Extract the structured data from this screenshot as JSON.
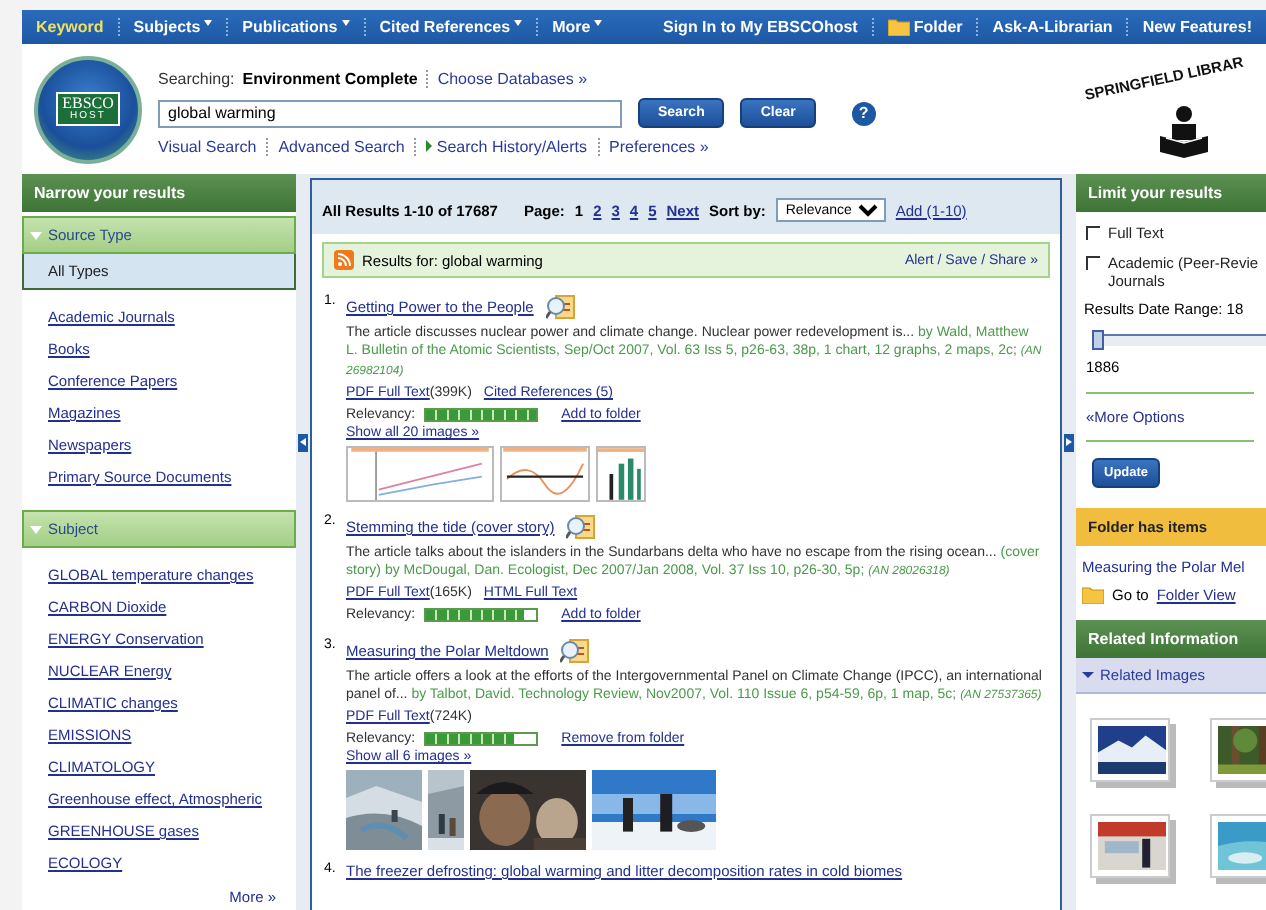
{
  "topnav": {
    "left": [
      {
        "label": "Keyword",
        "selected": true,
        "dropdown": false
      },
      {
        "label": "Subjects",
        "selected": false,
        "dropdown": true
      },
      {
        "label": "Publications",
        "selected": false,
        "dropdown": true
      },
      {
        "label": "Cited References",
        "selected": false,
        "dropdown": true
      },
      {
        "label": "More",
        "selected": false,
        "dropdown": true
      }
    ],
    "right": [
      {
        "label": "Sign In to My EBSCOhost",
        "kind": "link"
      },
      {
        "label": "Folder",
        "kind": "folder"
      },
      {
        "label": "Ask-A-Librarian",
        "kind": "link"
      },
      {
        "label": "New Features!",
        "kind": "link"
      }
    ]
  },
  "header": {
    "logo": "EBSCO",
    "logo_sub": "HOST",
    "searching_label": "Searching:",
    "database": "Environment Complete",
    "choose": "Choose Databases »",
    "query": "global warming",
    "buttons": [
      "Search",
      "Clear"
    ],
    "help": "?",
    "links": [
      {
        "label": "Visual Search",
        "arrow": false
      },
      {
        "label": "Advanced Search",
        "arrow": false
      },
      {
        "label": "Search History/Alerts",
        "arrow": true
      },
      {
        "label": "Preferences »",
        "arrow": false
      }
    ],
    "library": "SPRINGFIELD LIBRAR"
  },
  "left": {
    "title": "Narrow your results",
    "sections": [
      {
        "title": "Source Type",
        "expanded": true,
        "all_label": "All Types",
        "items": [
          "Academic Journals",
          "Books",
          "Conference Papers",
          "Magazines",
          "Newspapers",
          "Primary Source Documents"
        ]
      },
      {
        "title": "Subject",
        "expanded": true,
        "items": [
          "GLOBAL temperature changes",
          "CARBON Dioxide",
          "ENERGY Conservation",
          "NUCLEAR Energy",
          "CLIMATIC changes",
          "EMISSIONS",
          "CLIMATOLOGY",
          "Greenhouse effect, Atmospheric",
          "GREENHOUSE gases",
          "ECOLOGY"
        ],
        "more": "More »"
      }
    ]
  },
  "results": {
    "summary": "All Results 1-10 of 17687",
    "page_label": "Page:",
    "pages": [
      {
        "label": "1",
        "selected": true
      },
      {
        "label": "2",
        "selected": false
      },
      {
        "label": "3",
        "selected": false
      },
      {
        "label": "4",
        "selected": false
      },
      {
        "label": "5",
        "selected": false
      }
    ],
    "next": "Next",
    "sort_label": "Sort by:",
    "sort": "Relevance",
    "add": "Add (1-10)",
    "rss_label": "Results for: global warming",
    "alert": "Alert / Save / Share »",
    "items": [
      {
        "number": "1.",
        "title": "Getting Power to the People",
        "abstract": "The article discusses nuclear power and climate change. Nuclear power redevelopment is...",
        "citation": "by Wald, Matthew L. Bulletin of the Atomic Scientists, Sep/Oct 2007, Vol. 63 Iss 5, p26-63, 38p, 1 chart, 12 graphs, 2 maps, 2c;",
        "an": "(AN 26982104)",
        "links": [
          {
            "label": "PDF Full Text",
            "size": "(399K)"
          },
          {
            "label": "Cited References (5)"
          }
        ],
        "relevancy_label": "Relevancy:",
        "level": 1,
        "folder_action": "Add to folder",
        "images_link": "Show all 20 images »",
        "images": [
          {
            "kind": "chart"
          },
          {
            "kind": "chart"
          },
          {
            "kind": "chart"
          }
        ]
      },
      {
        "number": "2.",
        "title": "Stemming the tide (cover story)",
        "abstract": "The article talks about the islanders in the Sundarbans delta who have no escape from the rising ocean...",
        "citation": "(cover story) by McDougal, Dan. Ecologist, Dec 2007/Jan 2008, Vol. 37 Iss 10, p26-30, 5p;",
        "an": "(AN 28026318)",
        "links": [
          {
            "label": "PDF Full Text",
            "size": "(165K)"
          },
          {
            "label": "HTML Full Text"
          }
        ],
        "relevancy_label": "Relevancy:",
        "level": 0.9,
        "folder_action": "Add to folder"
      },
      {
        "number": "3.",
        "title": "Measuring the Polar Meltdown",
        "abstract": "The article offers a look at the efforts of the Intergovernmental Panel on Climate Change (IPCC), an international panel of...",
        "citation": "by Talbot, David. Technology Review, Nov2007, Vol. 110 Issue 6, p54-59, 6p, 1 map, 5c;",
        "an": "(AN 27537365)",
        "links": [
          {
            "label": "PDF Full Text",
            "size": "(724K)"
          }
        ],
        "relevancy_label": "Relevancy:",
        "level": 0.8,
        "folder_action": "Remove from folder",
        "images_link": "Show all 6 images »",
        "images": [
          {
            "kind": "picture"
          },
          {
            "kind": "picture"
          },
          {
            "kind": "picture"
          },
          {
            "kind": "picture"
          }
        ]
      },
      {
        "number": "4.",
        "title": "The freezer defrosting: global warming and litter decomposition rates in cold biomes"
      }
    ]
  },
  "right": {
    "title": "Limit your results",
    "checkboxes": [
      {
        "lines": [
          "Full Text"
        ],
        "checked": false
      },
      {
        "lines": [
          "Academic (Peer-Revie",
          "Journals"
        ],
        "checked": false
      }
    ],
    "date_label": "Results Date Range: 18",
    "slider": {
      "level": 0,
      "value": "1886"
    },
    "more_options": "«More Options",
    "update": "Update",
    "folder": {
      "title": "Folder has items",
      "items": [
        "Measuring the Polar Mel"
      ],
      "goto": "Go to",
      "view": "Folder View"
    },
    "related": {
      "title": "Related Information",
      "section": "Related Images",
      "expanded": true,
      "images": [
        {
          "kind": "picture"
        },
        {
          "kind": "picture"
        },
        {
          "kind": "picture"
        },
        {
          "kind": "picture"
        }
      ]
    }
  }
}
